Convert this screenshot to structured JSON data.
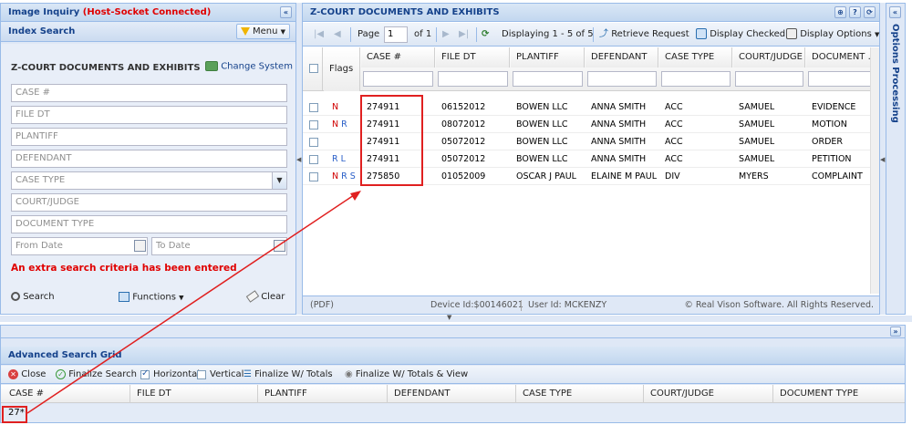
{
  "left_panel": {
    "title": "Image Inquiry",
    "title_status": "(Host-Socket Connected)",
    "collapse_icon": "double-chevron-left-icon",
    "index_search": {
      "title": "Index Search",
      "menu_label": "Menu"
    },
    "system_title": "Z-COURT DOCUMENTS AND EXHIBITS",
    "change_system_label": "Change System",
    "fields": {
      "case_no": "CASE #",
      "file_dt": "FILE DT",
      "plantiff": "PLANTIFF",
      "defendant": "DEFENDANT",
      "case_type": "CASE TYPE",
      "court_judge": "COURT/JUDGE",
      "document_type": "DOCUMENT TYPE",
      "from_date": "From Date",
      "to_date": "To Date"
    },
    "warning": "An extra search criteria has been entered",
    "buttons": {
      "search": "Search",
      "functions": "Functions",
      "clear": "Clear"
    }
  },
  "main_panel": {
    "title": "Z-COURT DOCUMENTS AND EXHIBITS",
    "toolbar": {
      "page_label": "Page",
      "page_value": "1",
      "of_label": "of 1",
      "displaying": "Displaying 1 - 5 of 5",
      "retrieve_request": "Retrieve Request",
      "display_checked": "Display Checked",
      "display_options": "Display Options"
    },
    "columns": {
      "flags": "Flags",
      "case_no": "CASE #",
      "file_dt": "FILE DT",
      "plantiff": "PLANTIFF",
      "defendant": "DEFENDANT",
      "case_type": "CASE TYPE",
      "court_judge": "COURT/JUDGE",
      "document": "DOCUMENT ..."
    },
    "rows": [
      {
        "flags": "N",
        "flags_color": "red",
        "case_no": "274911",
        "file_dt": "06152012",
        "plantiff": "BOWEN LLC",
        "defendant": "ANNA SMITH",
        "case_type": "ACC",
        "court_judge": "SAMUEL",
        "document": "EVIDENCE"
      },
      {
        "flags": "N R",
        "flags_color": "mixed",
        "case_no": "274911",
        "file_dt": "08072012",
        "plantiff": "BOWEN LLC",
        "defendant": "ANNA SMITH",
        "case_type": "ACC",
        "court_judge": "SAMUEL",
        "document": "MOTION"
      },
      {
        "flags": "",
        "flags_color": "none",
        "case_no": "274911",
        "file_dt": "05072012",
        "plantiff": "BOWEN LLC",
        "defendant": "ANNA SMITH",
        "case_type": "ACC",
        "court_judge": "SAMUEL",
        "document": "ORDER"
      },
      {
        "flags": "R L",
        "flags_color": "blue",
        "case_no": "274911",
        "file_dt": "05072012",
        "plantiff": "BOWEN LLC",
        "defendant": "ANNA SMITH",
        "case_type": "ACC",
        "court_judge": "SAMUEL",
        "document": "PETITION"
      },
      {
        "flags": "N R S",
        "flags_color": "mixed",
        "case_no": "275850",
        "file_dt": "01052009",
        "plantiff": "OSCAR J PAUL",
        "defendant": "ELAINE M PAUL",
        "case_type": "DIV",
        "court_judge": "MYERS",
        "document": "COMPLAINT"
      }
    ],
    "footer": {
      "pdf": "(PDF)",
      "device": "Device Id:$00146021",
      "user": "User Id: MCKENZY",
      "copyright": "© Real Vison Software. All Rights Reserved."
    }
  },
  "right_panel": {
    "title": "Options Processing"
  },
  "advanced": {
    "title": "Advanced Search Grid",
    "toolbar": {
      "close": "Close",
      "finalize_search": "Finalize Search",
      "horizontal": "Horizontal",
      "vertical": "Vertical",
      "finalize_totals": "Finalize W/ Totals",
      "finalize_totals_view": "Finalize W/ Totals & View"
    },
    "columns": {
      "case_no": "CASE #",
      "file_dt": "FILE DT",
      "plantiff": "PLANTIFF",
      "defendant": "DEFENDANT",
      "case_type": "CASE TYPE",
      "court_judge": "COURT/JUDGE",
      "document_type": "DOCUMENT TYPE"
    },
    "case_value": "27*"
  },
  "colors": {
    "accent": "#15428b",
    "warning": "#e00000",
    "highlight": "#e02020",
    "border": "#99bbe8"
  }
}
